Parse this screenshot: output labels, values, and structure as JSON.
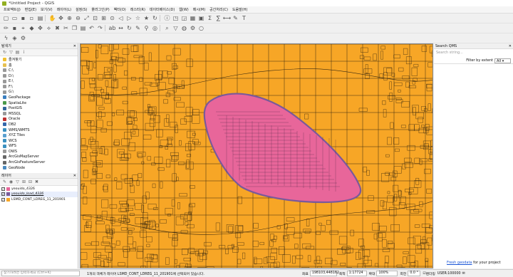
{
  "window": {
    "title": "*Untitled Project - QGIS"
  },
  "menu": [
    "프로젝트(J)",
    "편집(E)",
    "보기(V)",
    "레이어(L)",
    "설정(S)",
    "플러그인(P)",
    "벡터(O)",
    "래스터(R)",
    "데이터베이스(D)",
    "웹(W)",
    "메시(M)",
    "공간처리(C)",
    "도움말(H)"
  ],
  "toolbar_row1": [
    "new-file-icon",
    "open-icon",
    "save-icon",
    "save-as-icon",
    "print-icon",
    "sep",
    "pan-icon",
    "pan-selection-icon",
    "zoom-in-icon",
    "zoom-out-icon",
    "zoom-full-icon",
    "zoom-selection-icon",
    "zoom-layer-icon",
    "zoom-native-icon",
    "zoom-last-icon",
    "zoom-next-icon",
    "new-bookmark-icon",
    "show-bookmarks-icon",
    "refresh-icon",
    "sep",
    "identify-icon",
    "select-icon",
    "deselect-icon",
    "attribute-table-icon",
    "field-calculator-icon",
    "statistics-icon",
    "sum-icon",
    "measure-icon",
    "annotation-icon",
    "text-icon"
  ],
  "toolbar_row2": [
    "edit-pencil-icon",
    "save-edits-icon",
    "digitize-icon",
    "add-feature-icon",
    "move-feature-icon",
    "vertex-tool-icon",
    "delete-icon",
    "cut-icon",
    "copy-icon",
    "paste-icon",
    "undo-icon",
    "redo-icon",
    "sep",
    "label-icon",
    "label-move-icon",
    "label-rotate-icon",
    "label-change-icon",
    "label-pin-icon",
    "label-show-icon",
    "sep",
    "search-qms-icon",
    "filter-icon",
    "globe-icon",
    "settings-icon",
    "reload-icon"
  ],
  "toolbar_row3": [
    "python-icon",
    "plugin-icon",
    "processing-icon"
  ],
  "browser": {
    "title": "탐색기",
    "items": [
      {
        "label": "즐겨찾기",
        "icon": "star-icon",
        "color": "#f0c030"
      },
      {
        "label": "홈",
        "icon": "home-icon",
        "color": "#e6c050"
      },
      {
        "label": "C:\\",
        "icon": "drive-icon",
        "color": "#999999"
      },
      {
        "label": "D:\\",
        "icon": "drive-icon",
        "color": "#999999"
      },
      {
        "label": "E:\\",
        "icon": "drive-icon",
        "color": "#999999"
      },
      {
        "label": "F:\\",
        "icon": "drive-icon",
        "color": "#999999"
      },
      {
        "label": "G:\\",
        "icon": "drive-icon",
        "color": "#999999"
      },
      {
        "label": "GeoPackage",
        "icon": "geopackage-icon",
        "color": "#3a7fc0"
      },
      {
        "label": "SpatiaLite",
        "icon": "spatialite-icon",
        "color": "#4a9a4a"
      },
      {
        "label": "PostGIS",
        "icon": "postgis-icon",
        "color": "#336699"
      },
      {
        "label": "MSSQL",
        "icon": "mssql-icon",
        "color": "#999999"
      },
      {
        "label": "Oracle",
        "icon": "oracle-icon",
        "color": "#c03030"
      },
      {
        "label": "DB2",
        "icon": "db2-icon",
        "color": "#3366aa"
      },
      {
        "label": "WMS/WMTS",
        "icon": "wms-icon",
        "color": "#3a90c0"
      },
      {
        "label": "XYZ Tiles",
        "icon": "xyz-icon",
        "color": "#5aa0d0"
      },
      {
        "label": "WCS",
        "icon": "wcs-icon",
        "color": "#3a90c0"
      },
      {
        "label": "WFS",
        "icon": "wfs-icon",
        "color": "#3a90c0"
      },
      {
        "label": "OWS",
        "icon": "ows-icon",
        "color": "#999999"
      },
      {
        "label": "ArcGisMapServer",
        "icon": "arcgis-icon",
        "color": "#666666"
      },
      {
        "label": "ArcGisFeatureServer",
        "icon": "arcgis-icon",
        "color": "#666666"
      },
      {
        "label": "GeoNode",
        "icon": "geonode-icon",
        "color": "#4a8ac0"
      }
    ]
  },
  "layers": {
    "title": "레이어",
    "items": [
      {
        "label": "yeouido_4326",
        "checked": true,
        "color": "#e8669a",
        "selected": false
      },
      {
        "label": "yeouido_load_4326",
        "checked": true,
        "color": "#7a5a9a",
        "selected": true
      },
      {
        "label": "LSMD_CONT_LDREG_11_201901",
        "checked": true,
        "color": "#f7a626",
        "selected": false
      }
    ]
  },
  "search_qms": {
    "title": "Search QMS",
    "placeholder": "Search string...",
    "filter_label": "Filter by extent",
    "filter_value": "All",
    "footer_link": "Fresh geodata",
    "footer_text": "for your project"
  },
  "statusbar": {
    "locator_placeholder": "찾기하려면 입력하세요 (Ctrl+K)",
    "message": "1개의 객체가 레이어 LSMD_CONT_LDREG_11_201901에 선택되어 있습니다.",
    "coord_label": "좌표",
    "coord_value": "198103,448162",
    "scale_label": "축척",
    "scale_value": "1:17724",
    "magnifier_label": "확대",
    "magnifier_value": "100%",
    "rotation_label": "회전",
    "rotation_value": "0.0 °",
    "render_label": "렌더링",
    "crs_value": "USER:100000"
  },
  "colors": {
    "parcel_fill": "#f7a626",
    "yeouido_fill": "#e8669a",
    "road_outline": "#7a5a9a"
  }
}
